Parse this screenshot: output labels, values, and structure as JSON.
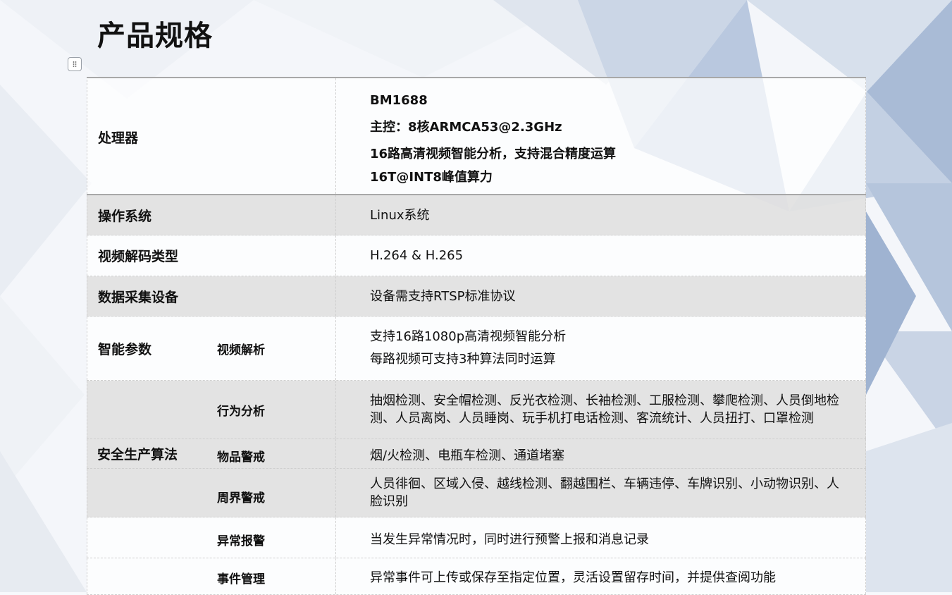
{
  "page": {
    "title": "产品规格"
  },
  "specs": {
    "processor": {
      "label": "处理器",
      "lines": [
        "BM1688",
        "主控：8核ARMCA53@2.3GHz",
        "16路高清视频智能分析，支持混合精度运算",
        "16T@INT8峰值算力"
      ]
    },
    "os": {
      "label": "操作系统",
      "value": "Linux系统"
    },
    "video_decode": {
      "label": "视频解码类型",
      "value": "H.264 & H.265"
    },
    "data_capture": {
      "label": "数据采集设备",
      "value": "设备需支持RTSP标准协议"
    },
    "smart_params": {
      "label": "智能参数",
      "sub_label": "视频解析",
      "lines": [
        "支持16路1080p高清视频智能分析",
        "每路视频可支持3种算法同时运算"
      ]
    },
    "safety_algorithms": {
      "label": "安全生产算法",
      "rows": [
        {
          "sub_label": "行为分析",
          "value": "抽烟检测、安全帽检测、反光衣检测、长袖检测、工服检测、攀爬检测、人员倒地检测、人员离岗、人员睡岗、玩手机打电话检测、客流统计、人员扭打、口罩检测"
        },
        {
          "sub_label": "物品警戒",
          "value": "烟/火检测、电瓶车检测、通道堵塞"
        },
        {
          "sub_label": "周界警戒",
          "value": "人员徘徊、区域入侵、越线检测、翻越围栏、车辆违停、车牌识别、小动物识别、人脸识别"
        }
      ]
    },
    "alarm": {
      "sub_label": "异常报警",
      "value": "当发生异常情况时，同时进行预警上报和消息记录"
    },
    "event_mgmt": {
      "sub_label": "事件管理",
      "value": "异常事件可上传或保存至指定位置，灵活设置留存时间，并提供查阅功能"
    }
  }
}
